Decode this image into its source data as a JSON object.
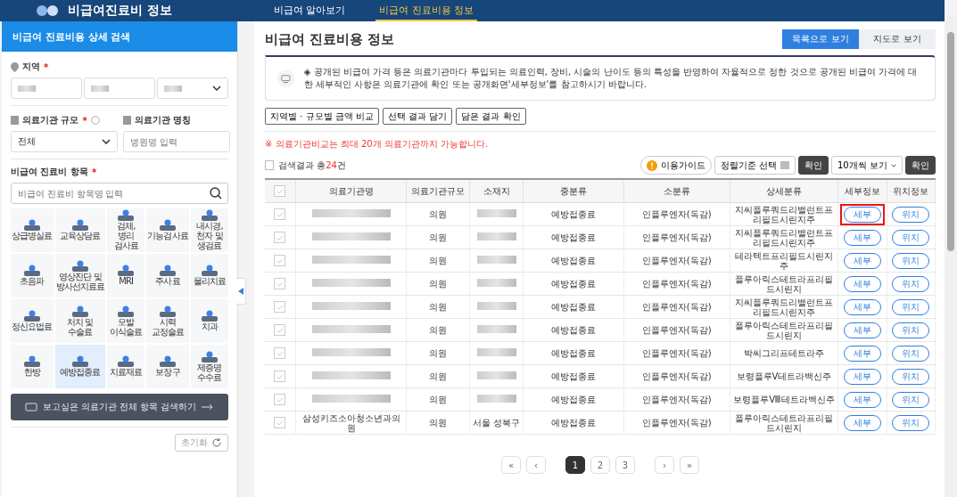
{
  "header": {
    "logo_text": "비급여진료비 정보",
    "nav": [
      {
        "label": "비급여 알아보기",
        "selected": false
      },
      {
        "label": "비급여 진료비용 정보",
        "selected": true
      }
    ]
  },
  "sidebar": {
    "title": "비급여 진료비용 상세 검색",
    "region": {
      "label": "지역",
      "required_mark": "*",
      "selects": [
        {
          "kind": "redacted"
        },
        {
          "kind": "redacted"
        },
        {
          "kind": "redacted"
        }
      ]
    },
    "scale": {
      "label": "의료기관 규모",
      "required_mark": "*",
      "value": "전체"
    },
    "name_field": {
      "label": "의료기관 명칭",
      "placeholder": "병원명 입력"
    },
    "items": {
      "label": "비급여 진료비 항목",
      "required_mark": "*",
      "placeholder": "비급여 진료비 항목명 입력"
    },
    "categories": [
      {
        "label": "상급병실료",
        "selected": false
      },
      {
        "label": "교육상담료",
        "selected": false
      },
      {
        "label": "검체, 병리 검사료",
        "selected": false
      },
      {
        "label": "기능검사료",
        "selected": false
      },
      {
        "label": "내시경, 천자 및 생검료",
        "selected": false
      },
      {
        "label": "초음파",
        "selected": false
      },
      {
        "label": "영상진단 및 방사선치료료",
        "selected": false
      },
      {
        "label": "MRI",
        "selected": false
      },
      {
        "label": "주사료",
        "selected": false
      },
      {
        "label": "물리치료",
        "selected": false
      },
      {
        "label": "정신요법료",
        "selected": false
      },
      {
        "label": "처치 및 수술료",
        "selected": false
      },
      {
        "label": "모발 이식술료",
        "selected": false
      },
      {
        "label": "시력 교정술료",
        "selected": false
      },
      {
        "label": "치과",
        "selected": false
      },
      {
        "label": "한방",
        "selected": false
      },
      {
        "label": "예방접종료",
        "selected": true
      },
      {
        "label": "치료재료",
        "selected": false
      },
      {
        "label": "보장구",
        "selected": false
      },
      {
        "label": "제증명 수수료",
        "selected": false
      }
    ],
    "search_all": "보고싶은 의료기관 전체 항목 검색하기",
    "reset": "초기화"
  },
  "main": {
    "title": "비급여 진료비용 정보",
    "view_tabs": [
      {
        "label": "목록으로 보기",
        "selected": true
      },
      {
        "label": "지도로 보기",
        "selected": false
      }
    ],
    "notice": "◈ 공개된 비급여 가격 등은 의료기관마다 투입되는 의료인력, 장비, 시술의 난이도 등의 특성을 반영하여 자율적으로 정한 것으로 공개된 비급여 가격에 대한 세부적인 사항은 의료기관에 확인 또는 공개화면'세부정보'를 참고하시기 바랍니다.",
    "actions": [
      "지역별 · 규모별 금액 비교",
      "선택 결과 담기",
      "담은 결과 확인"
    ],
    "warning": "※ 의료기관비교는 최대 20개 의료기관까지 가능합니다.",
    "result_prefix": "검색결과 총",
    "result_count": "24",
    "result_suffix": "건",
    "guide": "이용가이드",
    "sort": "정렬기준 선택",
    "confirm": "확인",
    "per_page": "10개씩 보기",
    "confirm2": "확인",
    "select_all_checked": false,
    "columns": [
      "의료기관명",
      "의료기관규모",
      "소재지",
      "중분류",
      "소분류",
      "상세분류",
      "세부정보",
      "위치정보"
    ],
    "rows": [
      {
        "checked": false,
        "scale": "의원",
        "mid": "예방접종료",
        "sub": "인플루엔자(독감)",
        "detail": "지씨플루쿼드리밸런트프리필드시린지주",
        "info": "세부",
        "loc": "위치",
        "highlighted": true
      },
      {
        "checked": false,
        "scale": "의원",
        "mid": "예방접종료",
        "sub": "인플루엔자(독감)",
        "detail": "지씨플루쿼드리밸런트프리필드시린지주",
        "info": "세부",
        "loc": "위치",
        "highlighted": false
      },
      {
        "checked": false,
        "scale": "의원",
        "mid": "예방접종료",
        "sub": "인플루엔자(독감)",
        "detail": "테라텍트프리필드시린지주",
        "info": "세부",
        "loc": "위치",
        "highlighted": false
      },
      {
        "checked": false,
        "scale": "의원",
        "mid": "예방접종료",
        "sub": "인플루엔자(독감)",
        "detail": "플루아릭스테트라프리필드시린지",
        "info": "세부",
        "loc": "위치",
        "highlighted": false
      },
      {
        "checked": false,
        "scale": "의원",
        "mid": "예방접종료",
        "sub": "인플루엔자(독감)",
        "detail": "지씨플루쿼드리밸런트프리필드시린지주",
        "info": "세부",
        "loc": "위치",
        "highlighted": false
      },
      {
        "checked": false,
        "scale": "의원",
        "mid": "예방접종료",
        "sub": "인플루엔자(독감)",
        "detail": "플루아릭스테트라프리필드시린지",
        "info": "세부",
        "loc": "위치",
        "highlighted": false
      },
      {
        "checked": false,
        "scale": "의원",
        "mid": "예방접종료",
        "sub": "인플루엔자(독감)",
        "detail": "박씨그리프테트라주",
        "info": "세부",
        "loc": "위치",
        "highlighted": false
      },
      {
        "checked": false,
        "scale": "의원",
        "mid": "예방접종료",
        "sub": "인플루엔자(독감)",
        "detail": "보령플루Ⅴ테트라백신주",
        "info": "세부",
        "loc": "위치",
        "highlighted": false
      },
      {
        "checked": false,
        "scale": "의원",
        "mid": "예방접종료",
        "sub": "인플루엔자(독감)",
        "detail": "보령플루Ⅷ테트라백신주",
        "info": "세부",
        "loc": "위치",
        "highlighted": false
      },
      {
        "checked": false,
        "name": "삼성키즈소아청소년과의원",
        "scale": "의원",
        "location": "서울 성북구",
        "mid": "예방접종료",
        "sub": "인플루엔자(독감)",
        "detail": "플루아릭스테트라프리필드시린지",
        "info": "세부",
        "loc": "위치",
        "highlighted": false
      }
    ],
    "pagination": {
      "first": "«",
      "prev": "‹",
      "pages": [
        {
          "label": "1",
          "selected": true
        },
        {
          "label": "2",
          "selected": false
        },
        {
          "label": "3",
          "selected": false
        }
      ],
      "next": "›",
      "last": "»"
    }
  }
}
